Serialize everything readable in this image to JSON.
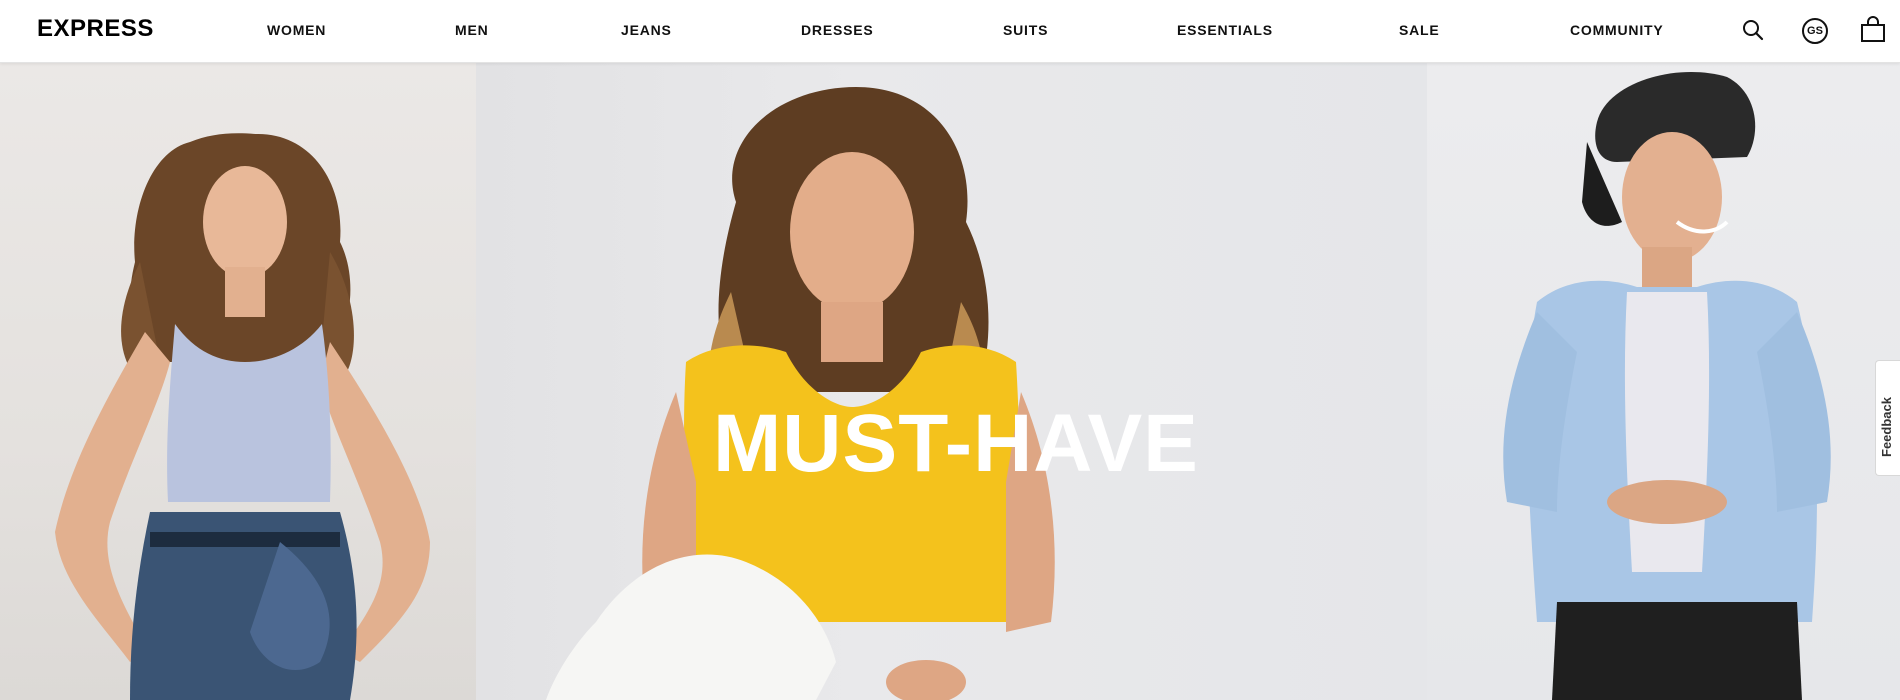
{
  "header": {
    "logo": "EXPRESS",
    "nav": [
      "WOMEN",
      "MEN",
      "JEANS",
      "DRESSES",
      "SUITS",
      "ESSENTIALS",
      "SALE",
      "COMMUNITY"
    ],
    "account_initials": "GS"
  },
  "hero": {
    "headline": "MUST-HAVE"
  },
  "feedback": {
    "label": "Feedback"
  },
  "colors": {
    "text": "#111111",
    "yellow_top": "#f4c21c",
    "blue_top": "#b9c3de",
    "shirt_blue": "#a9c6e6"
  }
}
